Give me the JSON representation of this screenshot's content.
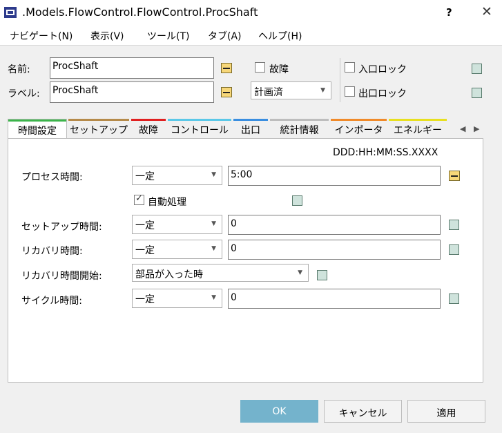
{
  "window": {
    "title": ".Models.FlowControl.FlowControl.ProcShaft",
    "help": "?",
    "close": "✕"
  },
  "menu": [
    "ナビゲート(N)",
    "表示(V)",
    "ツール(T)",
    "タブ(A)",
    "ヘルプ(H)"
  ],
  "header": {
    "name_label": "名前:",
    "name_value": "ProcShaft",
    "label_label": "ラベル:",
    "label_value": "ProcShaft",
    "failure_label": "故障",
    "plan_value": "計画済",
    "entry_lock_label": "入口ロック",
    "exit_lock_label": "出口ロック"
  },
  "tabs": [
    {
      "label": "時間設定",
      "color": "#3cb44b"
    },
    {
      "label": "セットアップ",
      "color": "#b58a4a"
    },
    {
      "label": "故障",
      "color": "#e02020"
    },
    {
      "label": "コントロール",
      "color": "#5bc8e8"
    },
    {
      "label": "出口",
      "color": "#3a8ee0"
    },
    {
      "label": "統計情報",
      "color": "#bdbdbd"
    },
    {
      "label": "インポータ",
      "color": "#f08a2a"
    },
    {
      "label": "エネルギー",
      "color": "#e8e020"
    }
  ],
  "tab_scroll": {
    "left": "◀",
    "right": "▶"
  },
  "timing": {
    "format_hint": "DDD:HH:MM:SS.XXXX",
    "process_time_label": "プロセス時間:",
    "process_time_type": "一定",
    "process_time_value": "5:00",
    "auto_process_label": "自動処理",
    "setup_time_label": "セットアップ時間:",
    "setup_time_type": "一定",
    "setup_time_value": "0",
    "recovery_time_label": "リカバリ時間:",
    "recovery_time_type": "一定",
    "recovery_time_value": "0",
    "recovery_start_label": "リカバリ時間開始:",
    "recovery_start_value": "部品が入った時",
    "cycle_time_label": "サイクル時間:",
    "cycle_time_type": "一定",
    "cycle_time_value": "0"
  },
  "buttons": {
    "ok": "OK",
    "cancel": "キャンセル",
    "apply": "適用"
  }
}
